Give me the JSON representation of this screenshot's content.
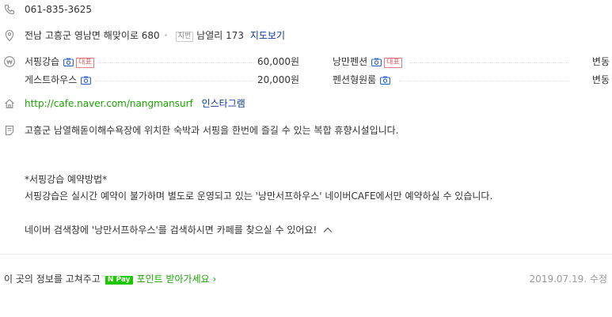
{
  "phone": {
    "number": "061-835-3625"
  },
  "address": {
    "road": "전남 고흥군 영남면 해맞이로 680",
    "jibun_tag": "지번",
    "jibun": "남열리 173",
    "map_link": "지도보기"
  },
  "menu": {
    "items": [
      {
        "name": "서핑강습",
        "price": "60,000원",
        "badge": "대표",
        "camera": true
      },
      {
        "name": "게스트하우스",
        "price": "20,000원",
        "badge": "",
        "camera": true
      },
      {
        "name": "낭만펜션",
        "price": "변동",
        "badge": "대표",
        "camera": true
      },
      {
        "name": "펜션형원룸",
        "price": "변동",
        "badge": "",
        "camera": true
      }
    ]
  },
  "homepage": {
    "url": "http://cafe.naver.com/nangmansurf",
    "instagram": "인스타그램"
  },
  "description": {
    "summary": "고흥군 남열해돋이해수욕장에 위치한 숙박과 서핑을 한번에 즐길 수 있는 복합 휴향시설입니다.",
    "title": "*서핑강습 예약방법*",
    "line1": "서핑강습은 실시간 예약이 불가하며 별도로 운영되고 있는 '낭만서프하우스' 네이버CAFE에서만 예약하실 수 있습니다.",
    "line2": "네이버 검색창에 '낭만서프하우스'를 검색하시면 카페를 찾으실 수 있어요!"
  },
  "footer": {
    "prompt": "이 곳의 정보를 고쳐주고",
    "npay_label": "N Pay",
    "points_link": "포인트 받아가세요 ›",
    "date": "2019.07.19.",
    "edit": "수정"
  },
  "colors": {
    "link": "#0b3a9e",
    "green": "#1aa400",
    "npay": "#1ec800",
    "badge_red": "#e05a5a"
  },
  "icons": [
    "phone-icon",
    "location-pin-icon",
    "won-icon",
    "camera-icon",
    "home-icon",
    "document-icon",
    "chevron-up-icon"
  ]
}
